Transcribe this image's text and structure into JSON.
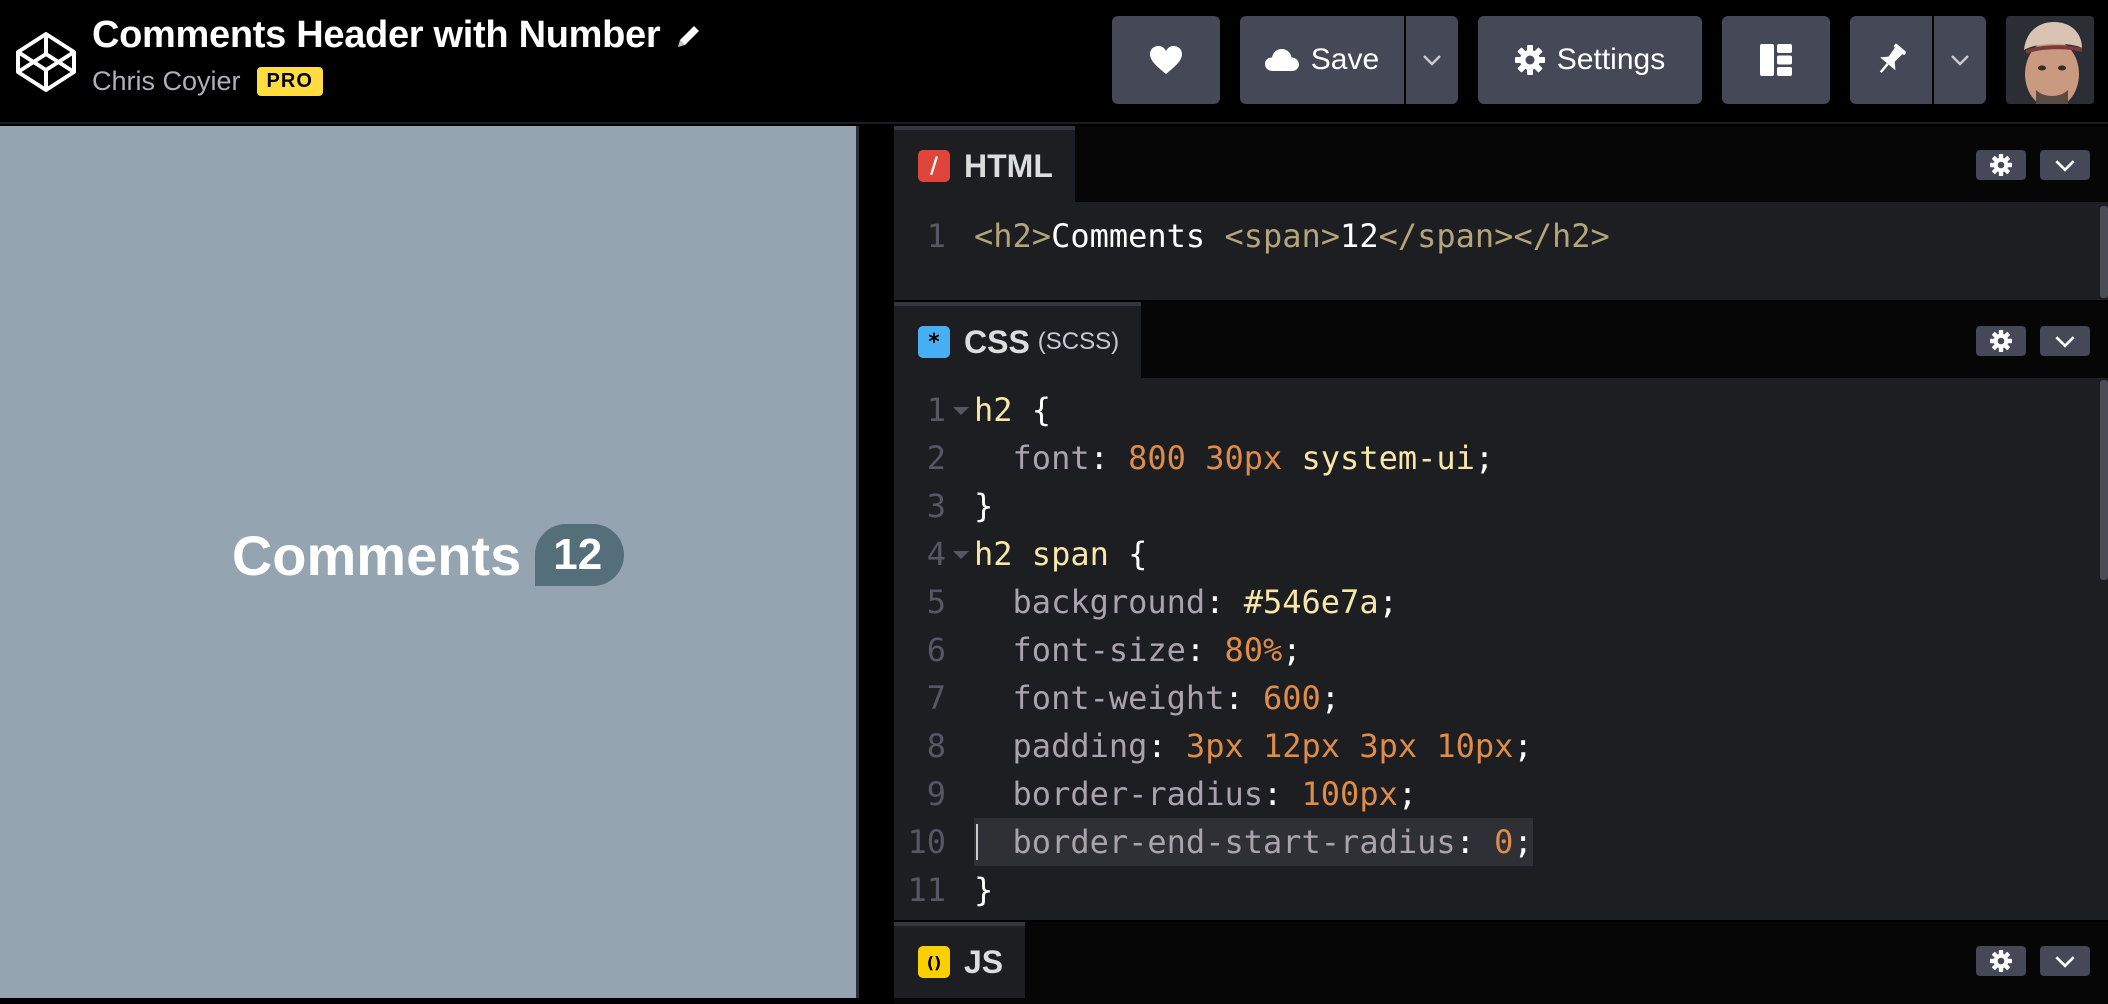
{
  "header": {
    "pen_title": "Comments Header with Number",
    "author": "Chris Coyier",
    "pro_badge": "PRO",
    "save_label": "Save",
    "settings_label": "Settings",
    "icons": [
      "codepen-logo-icon",
      "pencil-icon",
      "heart-icon",
      "cloud-icon",
      "chevron-down-icon",
      "gear-icon",
      "layout-icon",
      "pin-icon",
      "avatar"
    ]
  },
  "preview": {
    "heading": "Comments",
    "count": "12",
    "background": "#94a4b0",
    "badge_color": "#546e7a"
  },
  "editors": {
    "html": {
      "name": "HTML",
      "icon_glyph": "/",
      "icon_color": "#e0453c",
      "lines": [
        {
          "n": "1",
          "tokens": [
            [
              "t-tag",
              "<h2>"
            ],
            [
              "t-plain",
              "Comments "
            ],
            [
              "t-tag",
              "<span>"
            ],
            [
              "t-plain",
              "12"
            ],
            [
              "t-tag",
              "</span></h2>"
            ]
          ]
        }
      ]
    },
    "css": {
      "name": "CSS",
      "sub": "(SCSS)",
      "icon_glyph": "*",
      "icon_color": "#47b0f2",
      "lines": [
        {
          "n": "1",
          "fold": true,
          "tokens": [
            [
              "t-sel",
              "h2"
            ],
            [
              "t-punc",
              " {"
            ]
          ]
        },
        {
          "n": "2",
          "tokens": [
            [
              "t-punc",
              "  "
            ],
            [
              "t-prop",
              "font"
            ],
            [
              "t-punc",
              ": "
            ],
            [
              "t-num",
              "800"
            ],
            [
              "t-punc",
              " "
            ],
            [
              "t-num",
              "30px"
            ],
            [
              "t-punc",
              " "
            ],
            [
              "t-val",
              "system-ui"
            ],
            [
              "t-punc",
              ";"
            ]
          ]
        },
        {
          "n": "3",
          "tokens": [
            [
              "t-punc",
              "}"
            ]
          ]
        },
        {
          "n": "4",
          "fold": true,
          "tokens": [
            [
              "t-sel",
              "h2 span"
            ],
            [
              "t-punc",
              " {"
            ]
          ]
        },
        {
          "n": "5",
          "tokens": [
            [
              "t-punc",
              "  "
            ],
            [
              "t-prop",
              "background"
            ],
            [
              "t-punc",
              ": "
            ],
            [
              "t-val",
              "#546e7a"
            ],
            [
              "t-punc",
              ";"
            ]
          ]
        },
        {
          "n": "6",
          "tokens": [
            [
              "t-punc",
              "  "
            ],
            [
              "t-prop",
              "font-size"
            ],
            [
              "t-punc",
              ": "
            ],
            [
              "t-num",
              "80%"
            ],
            [
              "t-punc",
              ";"
            ]
          ]
        },
        {
          "n": "7",
          "tokens": [
            [
              "t-punc",
              "  "
            ],
            [
              "t-prop",
              "font-weight"
            ],
            [
              "t-punc",
              ": "
            ],
            [
              "t-num",
              "600"
            ],
            [
              "t-punc",
              ";"
            ]
          ]
        },
        {
          "n": "8",
          "tokens": [
            [
              "t-punc",
              "  "
            ],
            [
              "t-prop",
              "padding"
            ],
            [
              "t-punc",
              ": "
            ],
            [
              "t-num",
              "3px"
            ],
            [
              "t-punc",
              " "
            ],
            [
              "t-num",
              "12px"
            ],
            [
              "t-punc",
              " "
            ],
            [
              "t-num",
              "3px"
            ],
            [
              "t-punc",
              " "
            ],
            [
              "t-num",
              "10px"
            ],
            [
              "t-punc",
              ";"
            ]
          ]
        },
        {
          "n": "9",
          "tokens": [
            [
              "t-punc",
              "  "
            ],
            [
              "t-prop",
              "border-radius"
            ],
            [
              "t-punc",
              ": "
            ],
            [
              "t-num",
              "100px"
            ],
            [
              "t-punc",
              ";"
            ]
          ]
        },
        {
          "n": "10",
          "active": true,
          "tokens": [
            [
              "t-punc",
              "  "
            ],
            [
              "t-prop",
              "border-end-start-radius"
            ],
            [
              "t-punc",
              ": "
            ],
            [
              "t-num",
              "0"
            ],
            [
              "t-punc",
              ";"
            ]
          ]
        },
        {
          "n": "11",
          "tokens": [
            [
              "t-punc",
              "}"
            ]
          ]
        }
      ]
    },
    "js": {
      "name": "JS",
      "icon_glyph": "()",
      "icon_color": "#fcd000"
    }
  }
}
